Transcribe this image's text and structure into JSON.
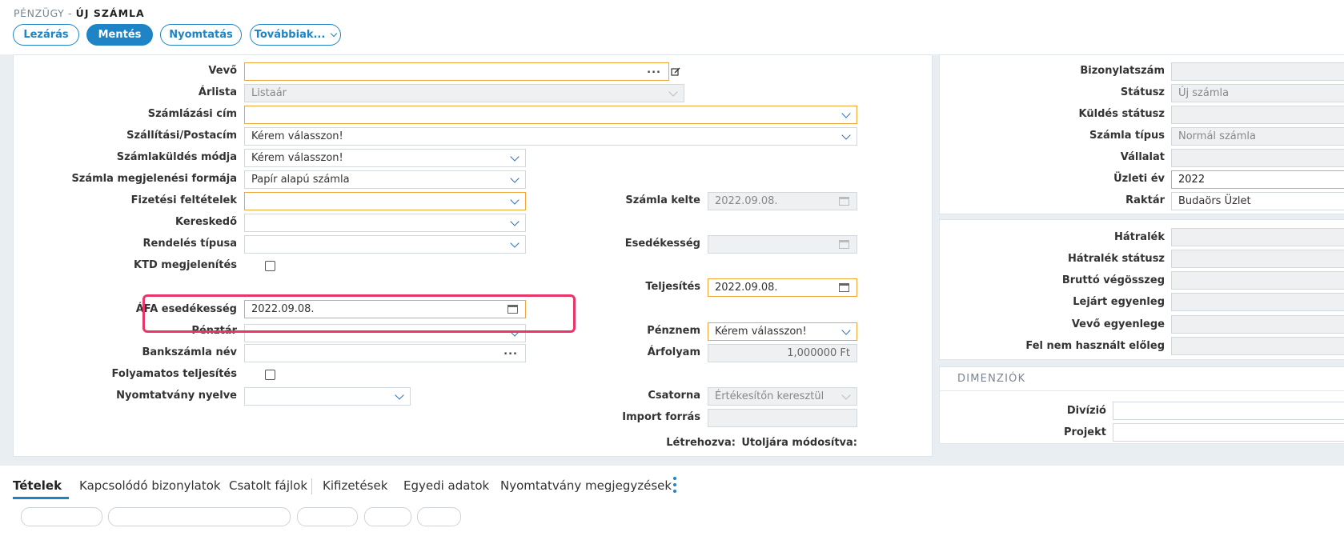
{
  "header": {
    "module": "PÉNZÜGY -",
    "title": "ÚJ SZÁMLA"
  },
  "toolbar": {
    "close_label": "Lezárás",
    "save_label": "Mentés",
    "print_label": "Nyomtatás",
    "more_label": "Továbbiak..."
  },
  "form": {
    "vevo_label": "Vevő",
    "vevo_value": "",
    "arlista_label": "Árlista",
    "arlista_value": "Listaár",
    "szamlazasi_cim_label": "Számlázási cím",
    "szamlazasi_cim_value": "",
    "szallitasi_label": "Szállítási/Postacím",
    "szallitasi_value": "Kérem válasszon!",
    "kuldes_modja_label": "Számlaküldés módja",
    "kuldes_modja_value": "Kérem válasszon!",
    "megjelenesi_label": "Számla megjelenési formája",
    "megjelenesi_value": "Papír alapú számla",
    "fizetesi_label": "Fizetési feltételek",
    "fizetesi_value": "",
    "kereskedo_label": "Kereskedő",
    "kereskedo_value": "",
    "rendeles_label": "Rendelés típusa",
    "rendeles_value": "",
    "ktd_label": "KTD megjelenítés",
    "afa_label": "ÁFA esedékesség",
    "afa_value": "2022.09.08.",
    "penztar_label": "Pénztár",
    "penztar_value": "",
    "bankszamla_label": "Bankszámla név",
    "bankszamla_value": "",
    "folyamatos_label": "Folyamatos teljesítés",
    "nyelv_label": "Nyomtatvány nyelve",
    "nyelv_value": "",
    "kelte_label": "Számla kelte",
    "kelte_value": "2022.09.08.",
    "esedekesseg_label": "Esedékesség",
    "esedekesseg_value": "",
    "teljesites_label": "Teljesítés",
    "teljesites_value": "2022.09.08.",
    "penznem_label": "Pénznem",
    "penznem_value": "Kérem válasszon!",
    "arfolyam_label": "Árfolyam",
    "arfolyam_value": "1,000000 Ft",
    "csatorna_label": "Csatorna",
    "csatorna_value": "Értékesítőn keresztül",
    "import_label": "Import forrás",
    "import_value": "",
    "letrehozva_label": "Létrehozva:",
    "modositva_label": "Utoljára módosítva:"
  },
  "right": {
    "bizonylatszam_label": "Bizonylatszám",
    "bizonylatszam_value": "",
    "statusz_label": "Státusz",
    "statusz_value": "Új számla",
    "kuldes_statusz_label": "Küldés státusz",
    "kuldes_statusz_value": "",
    "szamla_tipus_label": "Számla típus",
    "szamla_tipus_value": "Normál számla",
    "vallalat_label": "Vállalat",
    "vallalat_value": "",
    "uzleti_ev_label": "Üzleti év",
    "uzleti_ev_value": "2022",
    "raktar_label": "Raktár",
    "raktar_value": "Budaörs Üzlet",
    "hatralek_label": "Hátralék",
    "hatralek_statusz_label": "Hátralék státusz",
    "brutto_label": "Bruttó végösszeg",
    "lejart_label": "Lejárt egyenleg",
    "vevo_egyenleg_label": "Vevő egyenlege",
    "eloleg_label": "Fel nem használt előleg",
    "dimenziok_title": "DIMENZIÓK",
    "divizio_label": "Divízió",
    "projekt_label": "Projekt"
  },
  "tabs": [
    "Tételek",
    "Kapcsolódó bizonylatok",
    "Csatolt fájlok",
    "Kifizetések",
    "Egyedi adatok",
    "Nyomtatvány megjegyzések"
  ],
  "colors": {
    "accent": "#1f84c6",
    "required_border": "#f0a73a",
    "highlight": "#e8366b"
  }
}
